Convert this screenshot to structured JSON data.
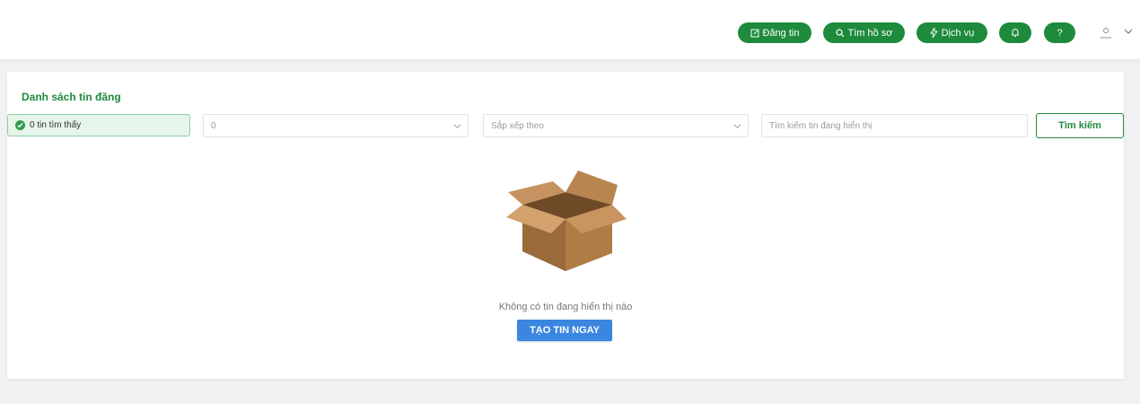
{
  "header": {
    "buttons": [
      {
        "label": "Đăng tin",
        "icon": "edit-icon"
      },
      {
        "label": "Tìm hồ sơ",
        "icon": "search-icon"
      },
      {
        "label": "Dịch vụ",
        "icon": "lightning-icon"
      },
      {
        "label": "",
        "icon": "bell-icon"
      },
      {
        "label": "?",
        "icon": "help-icon"
      }
    ],
    "user_icon": "user-icon",
    "menu_icon": "chevron-down-icon",
    "accent_color": "#1e8a3c"
  },
  "main": {
    "title": "Danh sách tin đăng",
    "found_text": "0 tin tìm thấy",
    "filter_select_value": "0",
    "sort_placeholder": "Sắp xếp theo",
    "search_placeholder": "Tìm kiếm tin đang hiển thị",
    "search_button": "Tìm kiếm",
    "empty_message": "Không có tin đang hiển thị nào",
    "create_button": "TẠO TIN NGAY",
    "create_button_color": "#3b86e0"
  }
}
